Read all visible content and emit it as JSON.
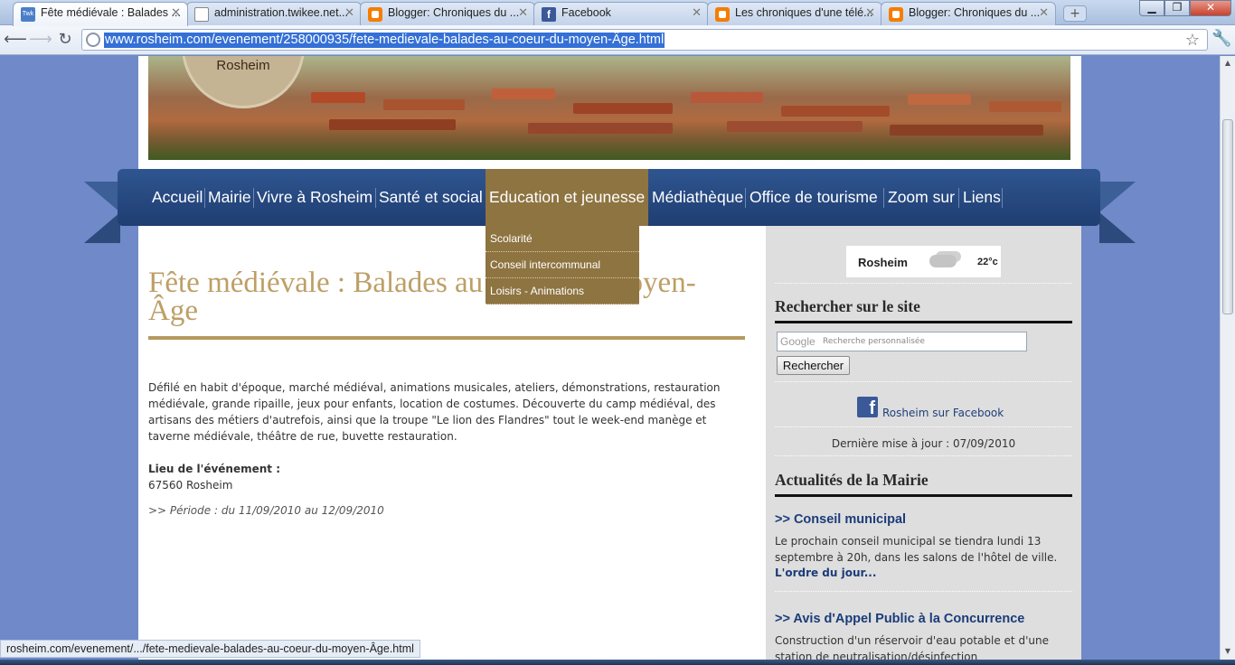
{
  "browser": {
    "tabs": [
      {
        "title": "Fête médiévale : Balades ...",
        "icon": "twikee-favicon",
        "active": true
      },
      {
        "title": "administration.twikee.net...",
        "icon": "document-icon",
        "active": false
      },
      {
        "title": "Blogger: Chroniques du ...",
        "icon": "blogger-icon",
        "active": false
      },
      {
        "title": "Facebook",
        "icon": "facebook-icon",
        "active": false
      },
      {
        "title": "Les chroniques d'une télé...",
        "icon": "blogger-icon",
        "active": false
      },
      {
        "title": "Blogger: Chroniques du ...",
        "icon": "blogger-icon",
        "active": false
      }
    ],
    "url": "www.rosheim.com/evenement/258000935/fete-medievale-balades-au-coeur-du-moyen-Âge.html",
    "status_url": "rosheim.com/evenement/.../fete-medievale-balades-au-coeur-du-moyen-Âge.html"
  },
  "site": {
    "logo_text": "Rosheim",
    "nav": [
      {
        "label": "Accueil"
      },
      {
        "label": "Mairie"
      },
      {
        "label": "Vivre à Rosheim"
      },
      {
        "label": "Santé et social"
      },
      {
        "label": "Education et jeunesse",
        "active": true
      },
      {
        "label": "Médiathèque"
      },
      {
        "label": "Office de tourisme"
      },
      {
        "label": "Zoom sur"
      },
      {
        "label": "Liens"
      }
    ],
    "dropdown": [
      "Scolarité",
      "Conseil intercommunal",
      "Loisirs - Animations"
    ]
  },
  "article": {
    "title": "Fête médiévale : Balades au coeur du Moyen-Âge",
    "body": "Défilé en habit d'époque, marché médiéval, animations musicales, ateliers, démonstrations, restauration médiévale, grande ripaille, jeux pour enfants, location de costumes. Découverte du camp médiéval, des artisans des métiers d'autrefois, ainsi que la troupe \"Le lion des Flandres\" tout le week-end manège et taverne médiévale, théâtre de rue, buvette restauration.",
    "location_label": "Lieu de l'événement :",
    "location_value": "67560 Rosheim",
    "period": ">> Période : du 11/09/2010 au 12/09/2010"
  },
  "sidebar": {
    "weather_city": "Rosheim",
    "weather_temp": "22°c",
    "search_heading": "Rechercher sur le site",
    "search_logo": "Google",
    "search_placeholder": "Recherche personnalisée",
    "search_button": "Rechercher",
    "facebook_link": "Rosheim sur Facebook",
    "last_update": "Dernière mise à jour : 07/09/2010",
    "news_heading": "Actualités de la Mairie",
    "news": [
      {
        "title": ">> Conseil municipal",
        "body": "Le prochain conseil municipal se tiendra lundi 13 septembre à 20h, dans les salons de l'hôtel de ville.",
        "more": "L'ordre du jour..."
      },
      {
        "title": ">> Avis d'Appel Public à la Concurrence",
        "body": "Construction d'un réservoir d'eau potable et d'une station de neutralisation/désinfection"
      }
    ]
  },
  "colors": {
    "nav_blue": "#2f5590",
    "nav_active": "#8e7441",
    "title_gold": "#bd9f66",
    "page_background": "#6f89c9"
  }
}
